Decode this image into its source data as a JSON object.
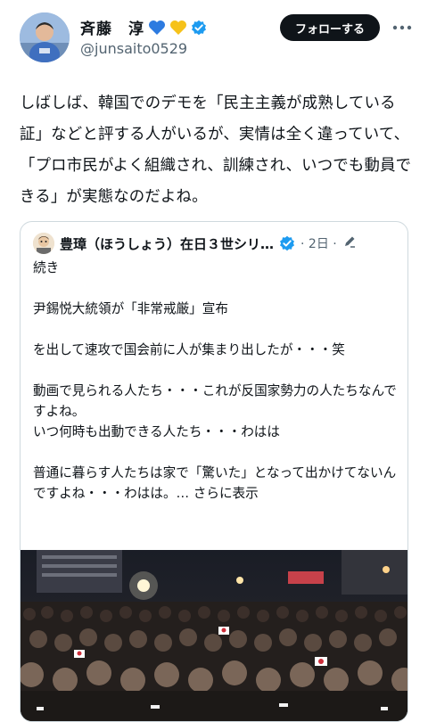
{
  "author": {
    "name": "斉藤　淳",
    "handle": "@junsaito0529",
    "emoji_icons": [
      "blue-heart-icon",
      "yellow-heart-icon"
    ],
    "verified_color": "#1d9bf0"
  },
  "follow_button": {
    "label": "フォローする"
  },
  "post": {
    "text": "しばしば、韓国でのデモを「民主主義が成熟している証」などと評する人がいるが、実情は全く違っていて、「プロ市民がよく組織され、訓練され、いつでも動員できる」が実態なのだよね。"
  },
  "quoted": {
    "name": "豊璋（ほうしょう）在日３世シリ…",
    "date": "· 2日 ·",
    "text": "続き\n\n尹錫悦大統領が「非常戒厳」宣布\n\nを出して速攻で国会前に人が集まり出したが・・・笑\n\n動画で見られる人たち・・・これが反国家勢力の人たちなんですよね。\nいつ何時も出動できる人たち・・・わはは\n\n普通に暮らす人たちは家で「驚いた」となって出かけてないんですよね・・・わはは。…",
    "show_more": " さらに表示",
    "image_icon": "crowd-photo"
  }
}
